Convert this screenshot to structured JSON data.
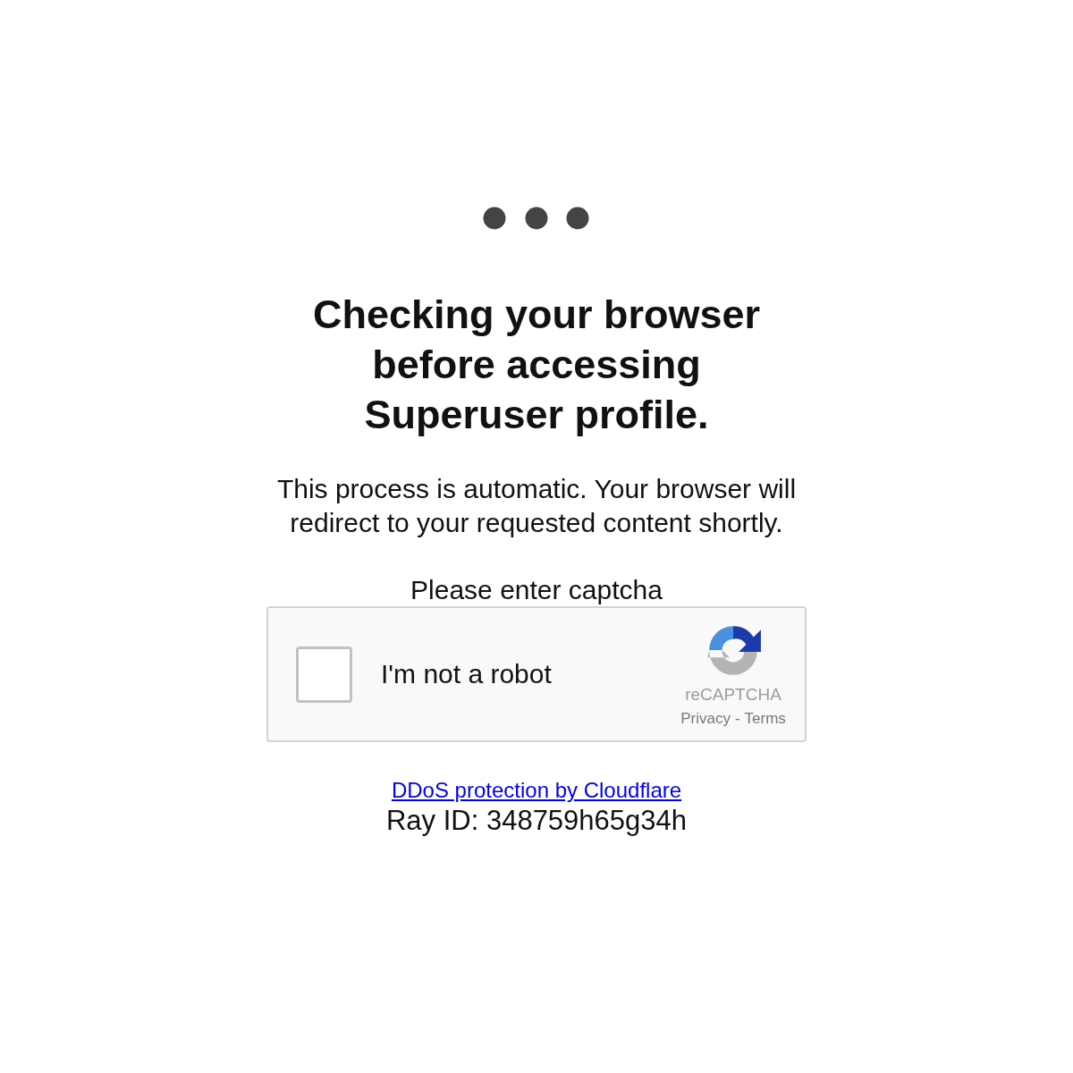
{
  "title": "Checking your browser before accessing Superuser profile.",
  "message": "This process is automatic. Your browser will redirect to your requested content shortly.",
  "captcha": {
    "prompt": "Please enter captcha",
    "checkbox": {
      "label": "I'm not a robot",
      "checked": false
    },
    "brand": "reCAPTCHA",
    "links": [
      "Privacy",
      "Terms"
    ],
    "separator": "-"
  },
  "footer": {
    "link": "DDoS protection by Cloudflare",
    "ray_id": "Ray ID: 348759h65g34h"
  }
}
